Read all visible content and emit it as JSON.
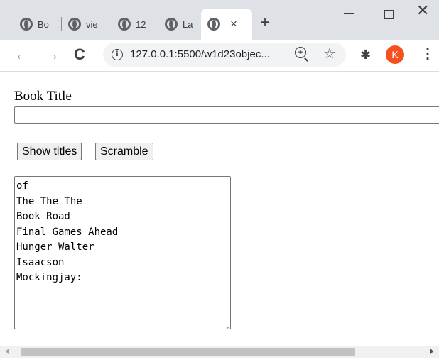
{
  "browser": {
    "tabs": [
      {
        "title": "Bo"
      },
      {
        "title": "vie"
      },
      {
        "title": "12"
      },
      {
        "title": "La"
      },
      {
        "title": ""
      }
    ],
    "active_tab_index": 4,
    "new_tab_label": "+",
    "close_tab_label": "×",
    "url": "127.0.0.1:5500/w1d23objec...",
    "avatar_initial": "K",
    "icons": [
      "back-icon",
      "forward-icon",
      "reload-icon",
      "info-icon",
      "zoom-icon",
      "star-icon",
      "extensions-icon",
      "menu-icon"
    ],
    "accent_colors": {
      "avatar": "#f4511e",
      "tabstrip": "#dee1e6"
    }
  },
  "form": {
    "book_title_label": "Book Title",
    "book_title_value": "",
    "show_titles_label": "Show titles",
    "scramble_label": "Scramble"
  },
  "output": {
    "lines": [
      "of",
      "The The The",
      "Book Road",
      "Final Games Ahead",
      "Hunger Walter",
      "Isaacson",
      "Mockingjay:"
    ]
  }
}
